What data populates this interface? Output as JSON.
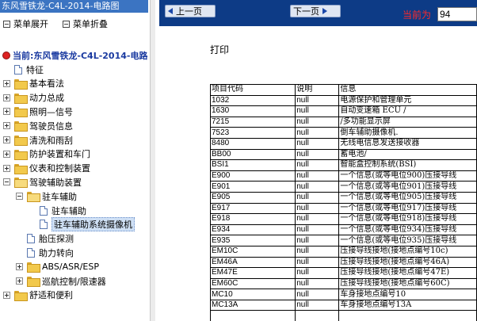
{
  "left": {
    "title": "东风雪铁龙-C4L-2014-电路图",
    "menu": {
      "expand": "菜单展开",
      "collapse": "菜单折叠"
    },
    "current": "当前:东风雪铁龙-C4L-2014-电路",
    "tree": [
      {
        "label": "特征",
        "kind": "doc"
      },
      {
        "label": "基本看法",
        "kind": "folder"
      },
      {
        "label": "动力总成",
        "kind": "folder"
      },
      {
        "label": "照明—信号",
        "kind": "folder"
      },
      {
        "label": "驾驶员信息",
        "kind": "folder"
      },
      {
        "label": "清洗和雨刮",
        "kind": "folder"
      },
      {
        "label": "防护装置和车门",
        "kind": "folder"
      },
      {
        "label": "仪表和控制装置",
        "kind": "folder"
      },
      {
        "label": "驾驶辅助装置",
        "kind": "folder-open"
      },
      {
        "label": "驻车辅助",
        "kind": "folder-open"
      },
      {
        "label": "驻车辅助",
        "kind": "doc"
      },
      {
        "label": "驻车辅助系统摄像机",
        "kind": "doc",
        "selected": true
      },
      {
        "label": "胎压探测",
        "kind": "doc"
      },
      {
        "label": "助力转向",
        "kind": "doc"
      },
      {
        "label": "ABS/ASR/ESP",
        "kind": "folder"
      },
      {
        "label": "巡航控制/限速器",
        "kind": "folder"
      },
      {
        "label": "舒适和便利",
        "kind": "folder"
      }
    ]
  },
  "toolbar": {
    "prev": "上一页",
    "next": "下一页",
    "page_label": "当前为",
    "page_value": "94"
  },
  "doc": {
    "title": "打印",
    "table": {
      "headers": [
        "项目代码",
        "说明",
        "信息"
      ],
      "rows": [
        [
          "1032",
          "null",
          "电源保护和管理单元"
        ],
        [
          "1630",
          "null",
          "自动变速箱 ECU /"
        ],
        [
          "7215",
          "null",
          "/多功能显示屏"
        ],
        [
          "7523",
          "null",
          "倒车辅助摄像机."
        ],
        [
          "8480",
          "null",
          "无线电信息发送接收器"
        ],
        [
          "BB00",
          "null",
          "蓄电池/"
        ],
        [
          "BSI1",
          "null",
          "智能盒控制系统(BSI)"
        ],
        [
          "E900",
          "null",
          "一个信息(或等电位900)压接导线"
        ],
        [
          "E901",
          "null",
          "一个信息(或等电位901)压接导线"
        ],
        [
          "E905",
          "null",
          "一个信息(或等电位905)压接导线"
        ],
        [
          "E917",
          "null",
          "一个信息(或等电位917)压接导线"
        ],
        [
          "E918",
          "null",
          "一个信息(或等电位918)压接导线"
        ],
        [
          "E934",
          "null",
          "一个信息(或等电位934)压接导线"
        ],
        [
          "E935",
          "null",
          "一个信息(或等电位935)压接导线"
        ],
        [
          "EM10C",
          "null",
          "压接导线接地(接地点编号10c)"
        ],
        [
          "EM46A",
          "null",
          "压接导线接地(接地点编号46A)"
        ],
        [
          "EM47E",
          "null",
          "压接导线接地(接地点编号47E)"
        ],
        [
          "EM60C",
          "null",
          "压接导线接地(接地点编号60C)"
        ],
        [
          "MC10",
          "null",
          "车身接地点编号10"
        ],
        [
          "MC13A",
          "null",
          "车身接地点编号13A"
        ],
        [
          "",
          "",
          ""
        ]
      ]
    }
  }
}
